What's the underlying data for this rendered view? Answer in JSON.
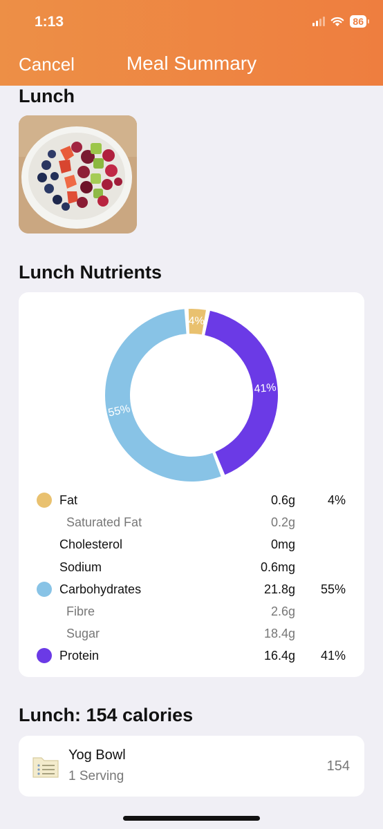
{
  "status_bar": {
    "time": "1:13",
    "battery": "86"
  },
  "nav": {
    "cancel_label": "Cancel",
    "title": "Meal Summary"
  },
  "meal": {
    "title": "Lunch"
  },
  "nutrients": {
    "title": "Lunch Nutrients",
    "chart_data": {
      "type": "pie",
      "categories": [
        "Fat",
        "Protein",
        "Carbohydrates"
      ],
      "values": [
        4,
        41,
        55
      ],
      "labels": [
        "4%",
        "41%",
        "55%"
      ],
      "colors": [
        "#e9c16f",
        "#6b3ae6",
        "#88c3e6"
      ],
      "style": "donut"
    },
    "rows": [
      {
        "name": "Fat",
        "amount": "0.6g",
        "pct": "4%",
        "dot": "#e9c16f",
        "sub": false
      },
      {
        "name": "Saturated Fat",
        "amount": "0.2g",
        "pct": "",
        "dot": "",
        "sub": true
      },
      {
        "name": "Cholesterol",
        "amount": "0mg",
        "pct": "",
        "dot": "",
        "sub": false
      },
      {
        "name": "Sodium",
        "amount": "0.6mg",
        "pct": "",
        "dot": "",
        "sub": false
      },
      {
        "name": "Carbohydrates",
        "amount": "21.8g",
        "pct": "55%",
        "dot": "#88c3e6",
        "sub": false
      },
      {
        "name": "Fibre",
        "amount": "2.6g",
        "pct": "",
        "dot": "",
        "sub": true
      },
      {
        "name": "Sugar",
        "amount": "18.4g",
        "pct": "",
        "dot": "",
        "sub": true
      },
      {
        "name": "Protein",
        "amount": "16.4g",
        "pct": "41%",
        "dot": "#6b3ae6",
        "sub": false
      }
    ]
  },
  "calories": {
    "title": "Lunch: 154 calories",
    "items": [
      {
        "name": "Yog Bowl",
        "serving": "1 Serving",
        "calories": "154",
        "icon": "food-list-icon"
      }
    ]
  },
  "colors": {
    "header": "#ee7e3f",
    "background": "#f0eff5"
  }
}
